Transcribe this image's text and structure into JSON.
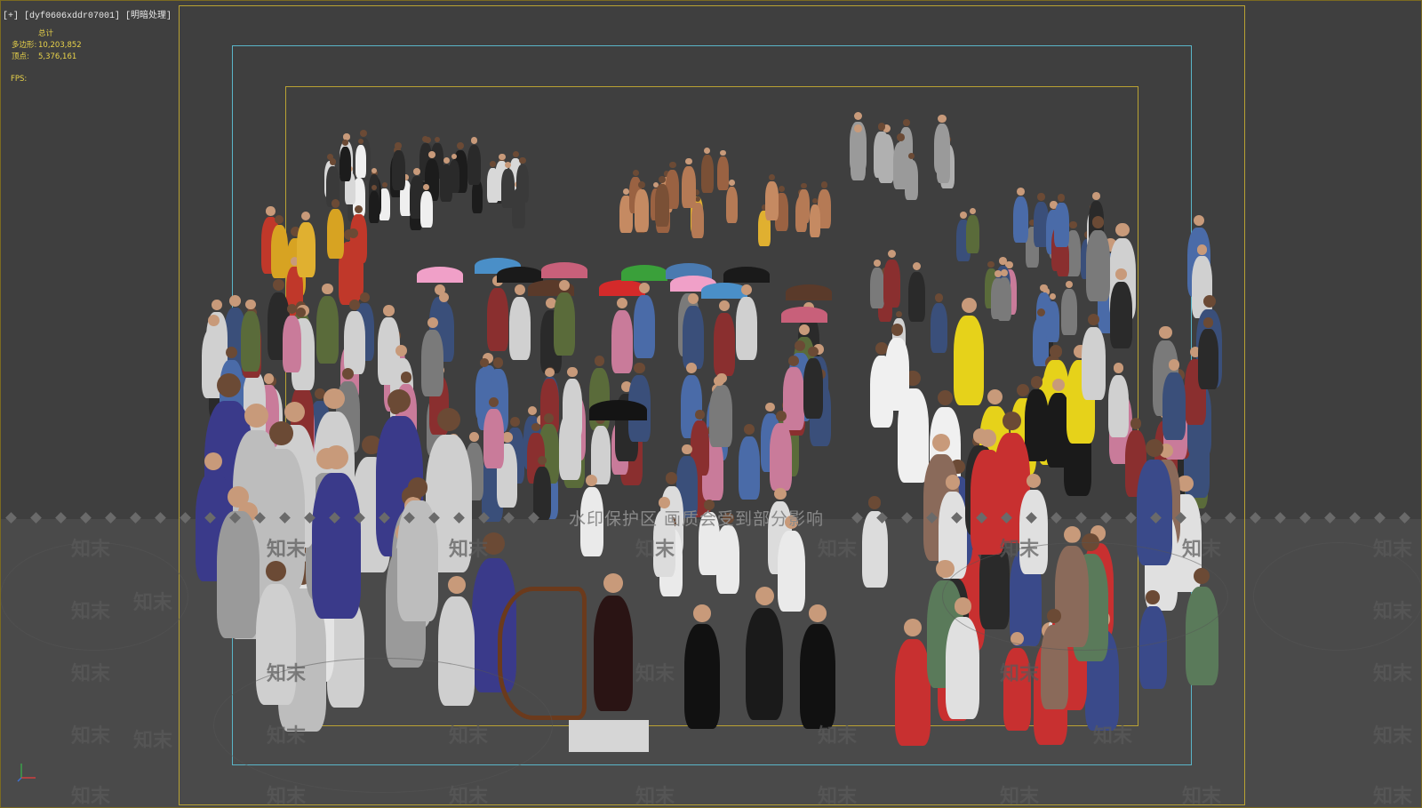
{
  "viewport": {
    "label": "[+] [dyf0606xddr07001] [明暗处理]",
    "stats": {
      "header": "总计",
      "polygons_label": "多边形:",
      "polygons_value": "10,203,852",
      "vertices_label": "顶点:",
      "vertices_value": "5,376,161",
      "fps_label": "FPS:"
    },
    "watermark_banner": "水印保护区 画质会受到部分影响",
    "watermark_logo": "知末"
  },
  "colors": {
    "background": "#3f3f3f",
    "render_frame": "#b9a233",
    "safe_frame": "#5ab5c8",
    "stats_text": "#e8d24a"
  }
}
